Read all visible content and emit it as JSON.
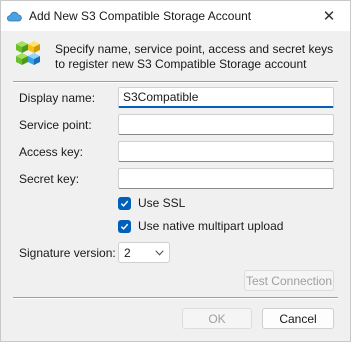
{
  "window": {
    "title": "Add New S3 Compatible Storage Account",
    "close_glyph": "✕",
    "app_icon": "cloud-icon",
    "header_icon": "storage-cubes-icon"
  },
  "header": {
    "text": "Specify name, service point, access and secret keys to register new S3 Compatible Storage account"
  },
  "form": {
    "display_name_label": "Display name:",
    "display_name_value": "S3Compatible",
    "service_point_label": "Service point:",
    "service_point_value": "",
    "access_key_label": "Access key:",
    "access_key_value": "",
    "secret_key_label": "Secret key:",
    "secret_key_value": "",
    "use_ssl_label": "Use SSL",
    "use_ssl_checked": true,
    "multipart_label": "Use native multipart upload",
    "multipart_checked": true,
    "signature_label": "Signature version:",
    "signature_value": "2"
  },
  "buttons": {
    "test_connection": "Test Connection",
    "ok": "OK",
    "cancel": "Cancel"
  },
  "colors": {
    "accent": "#005fb8",
    "window_bg": "#f0f0f0",
    "disabled_text": "#a0a0a0"
  }
}
